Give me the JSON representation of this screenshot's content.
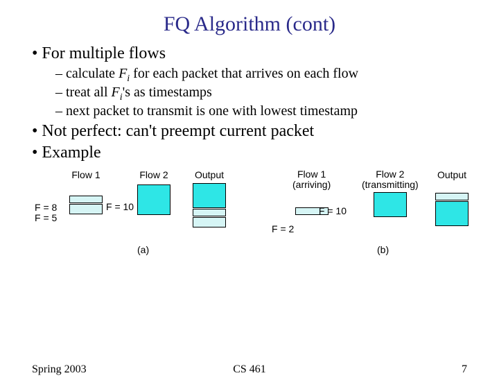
{
  "title": "FQ Algorithm (cont)",
  "bullets": {
    "b1": "For multiple flows",
    "b1a_pre": "calculate ",
    "b1a_F": "F",
    "b1a_i": "i",
    "b1a_post": " for each packet that arrives on each flow",
    "b1b_pre": "treat all ",
    "b1b_F": "F",
    "b1b_i": "i",
    "b1b_post": "'s as timestamps",
    "b1c": "next packet to transmit is one with lowest timestamp",
    "b2": "Not perfect: can't preempt current packet",
    "b3": "Example"
  },
  "diagram": {
    "a": {
      "flow1": "Flow 1",
      "flow2": "Flow 2",
      "output": "Output",
      "f8": "F = 8",
      "f5": "F = 5",
      "f10": "F = 10",
      "caption": "(a)"
    },
    "b": {
      "flow1": "Flow 1\n(arriving)",
      "flow2": "Flow 2\n(transmitting)",
      "output": "Output",
      "f10": "F = 10",
      "f2": "F = 2",
      "caption": "(b)"
    }
  },
  "footer": {
    "left": "Spring 2003",
    "center": "CS 461",
    "right": "7"
  }
}
